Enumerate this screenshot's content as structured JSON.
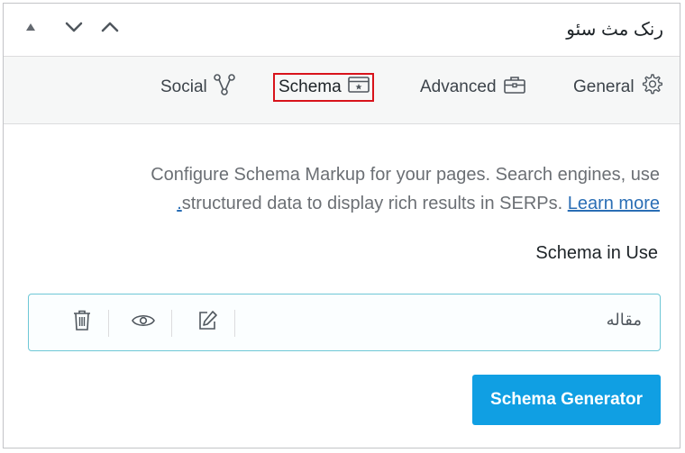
{
  "panel": {
    "title": "رنک مث سئو",
    "header_icons": [
      "triangle-up-icon",
      "chevron-down-icon",
      "chevron-up-icon"
    ]
  },
  "tabs": [
    {
      "label": "General",
      "icon": "gear-icon"
    },
    {
      "label": "Advanced",
      "icon": "toolbox-icon"
    },
    {
      "label": "Schema",
      "icon": "schema-window-icon",
      "selected": true
    },
    {
      "label": "Social",
      "icon": "share-nodes-icon"
    }
  ],
  "description": {
    "line1": "Configure Schema Markup for your pages. Search engines, use",
    "line2_text": "structured data to display rich results in SERPs.",
    "line2_period": ".",
    "learn_more": "Learn more"
  },
  "schema_in_use": {
    "title": "Schema in Use",
    "items": [
      {
        "name": "مقاله",
        "actions": [
          "edit-icon",
          "eye-icon",
          "trash-icon"
        ]
      }
    ]
  },
  "generator_button": "Schema Generator",
  "colors": {
    "accent": "#109fe3",
    "selection_outline": "#d8131b",
    "link": "#2a6eb5",
    "schema_border": "#6ec7d6"
  }
}
